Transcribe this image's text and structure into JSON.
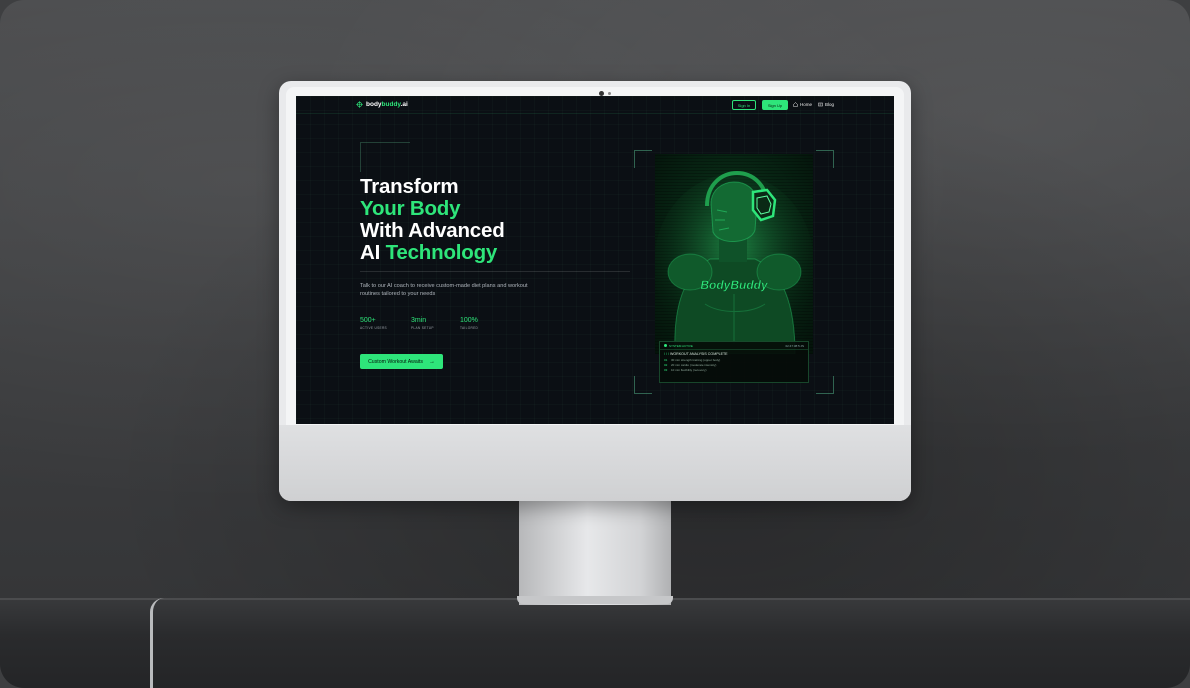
{
  "brand": {
    "prefix": "body",
    "accent": "buddy",
    "suffix": ".ai"
  },
  "nav": {
    "signin": "Sign In",
    "signup": "Sign Up",
    "home": "Home",
    "blog": "Blog"
  },
  "hero": {
    "line1": "Transform",
    "line2": "Your Body",
    "line3": "With Advanced",
    "line4a": "AI",
    "line4b": "Technology",
    "subtitle": "Talk to our AI coach to receive custom-made diet plans and workout routines tailored to your needs",
    "cta": "Custom Workout Awaits",
    "cta_arrow": "→"
  },
  "stats": [
    {
      "value": "500+",
      "label": "ACTIVE USERS"
    },
    {
      "value": "3min",
      "label": "PLAN SETUP"
    },
    {
      "value": "100%",
      "label": "TAILORED"
    }
  ],
  "visual": {
    "chest_text": "BodyBuddy"
  },
  "terminal": {
    "status": "SYSTEM ACTIVE",
    "time": "02:47:38:5:JS",
    "prefix": "/ / /",
    "title": "WORKOUT ANALYSIS COMPLETE",
    "rows": [
      {
        "n": "01",
        "text": "30 min strength training (upper body)"
      },
      {
        "n": "02",
        "text": "20 min cardio (moderate intensity)"
      },
      {
        "n": "03",
        "text": "10 min flexibility (recovery)"
      }
    ]
  },
  "colors": {
    "accent": "#2ee57a",
    "screen_bg": "#0b0f14"
  }
}
